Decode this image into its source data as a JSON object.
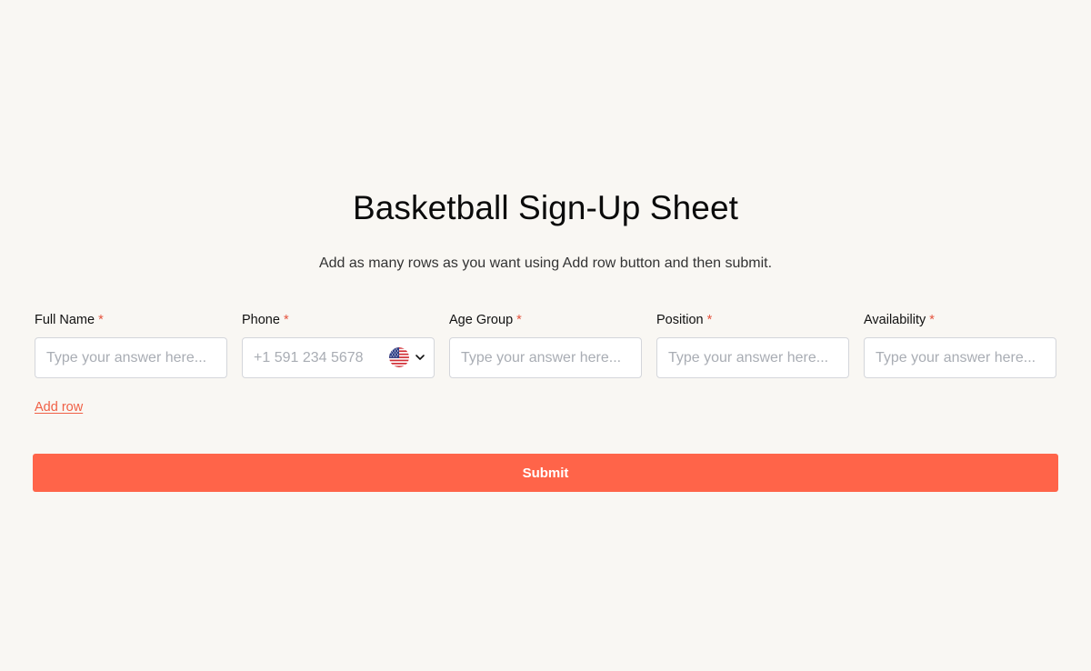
{
  "form": {
    "title": "Basketball Sign-Up Sheet",
    "subtitle": "Add as many rows as you want using Add row button and then submit.",
    "required_marker": "*",
    "fields": [
      {
        "label": "Full Name",
        "placeholder": "Type your answer here...",
        "value": ""
      },
      {
        "label": "Phone",
        "placeholder": "+1 591 234 5678",
        "value": "",
        "country_flag": "us-flag-icon"
      },
      {
        "label": "Age Group",
        "placeholder": "Type your answer here...",
        "value": ""
      },
      {
        "label": "Position",
        "placeholder": "Type your answer here...",
        "value": ""
      },
      {
        "label": "Availability",
        "placeholder": "Type your answer here...",
        "value": ""
      }
    ],
    "add_row_label": "Add row",
    "submit_label": "Submit"
  },
  "colors": {
    "background": "#f9f7f3",
    "accent": "#ff6449",
    "required": "#e5533d",
    "link": "#f06046",
    "input_border": "#d4d6db",
    "placeholder": "#a9adb4"
  }
}
